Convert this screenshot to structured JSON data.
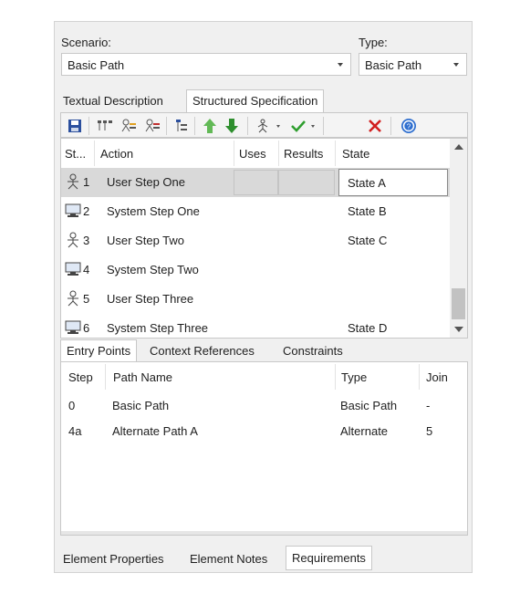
{
  "scenario": {
    "label": "Scenario:",
    "value": "Basic Path"
  },
  "type": {
    "label": "Type:",
    "value": "Basic Path"
  },
  "top_tabs": [
    {
      "label": "Textual Description",
      "active": false
    },
    {
      "label": "Structured Specification",
      "active": true
    }
  ],
  "toolbar": [
    "save-icon",
    "insert-steps-icon",
    "add-actor-step-icon",
    "add-system-step-icon",
    "hierarchy-icon",
    "move-up-icon",
    "move-down-icon",
    "generate-diagram-icon",
    "validate-icon",
    "delete-icon",
    "help-icon"
  ],
  "steps_grid": {
    "headers": {
      "step": "St...",
      "action": "Action",
      "uses": "Uses",
      "results": "Results",
      "state": "State"
    },
    "rows": [
      {
        "icon": "actor-icon",
        "num": "1",
        "action": "User Step One",
        "state": "State A",
        "selected": true
      },
      {
        "icon": "system-icon",
        "num": "2",
        "action": "System Step One",
        "state": "State B",
        "selected": false
      },
      {
        "icon": "actor-icon",
        "num": "3",
        "action": "User Step Two",
        "state": "State C",
        "selected": false
      },
      {
        "icon": "system-icon",
        "num": "4",
        "action": "System Step Two",
        "state": "",
        "selected": false
      },
      {
        "icon": "actor-icon",
        "num": "5",
        "action": "User Step Three",
        "state": "",
        "selected": false
      },
      {
        "icon": "system-icon",
        "num": "6",
        "action": "System Step Three",
        "state": "State D",
        "selected": false
      }
    ]
  },
  "sub_tabs": [
    {
      "label": "Entry Points",
      "active": true
    },
    {
      "label": "Context References",
      "active": false
    },
    {
      "label": "Constraints",
      "active": false
    }
  ],
  "entry_points": {
    "headers": {
      "step": "Step",
      "path_name": "Path Name",
      "type": "Type",
      "join": "Join"
    },
    "rows": [
      {
        "step": "0",
        "path_name": "Basic Path",
        "type": "Basic Path",
        "join": "-"
      },
      {
        "step": "4a",
        "path_name": "Alternate Path A",
        "type": "Alternate",
        "join": "5"
      }
    ]
  },
  "bottom_tabs": [
    {
      "label": "Element Properties",
      "active": false
    },
    {
      "label": "Element Notes",
      "active": false
    },
    {
      "label": "Requirements",
      "active": true
    }
  ],
  "colors": {
    "selected_row": "#d9d9d9",
    "save": "#2b4f9e",
    "arrow_up": "#62b956",
    "arrow_down": "#2e8f2e",
    "check": "#2e9e2e",
    "delete": "#d21f1f",
    "help": "#2f6fcf"
  }
}
